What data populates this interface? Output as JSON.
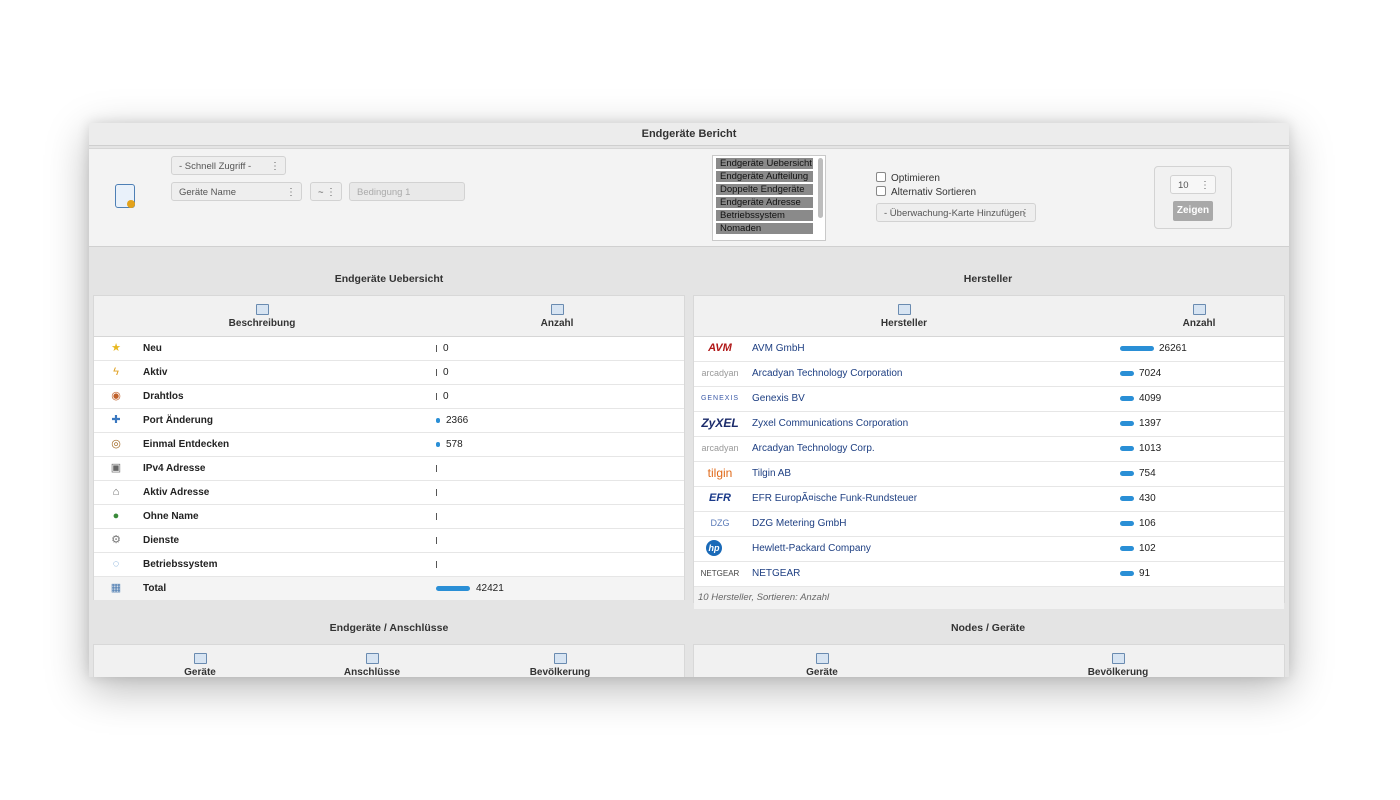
{
  "window": {
    "title": "Endgeräte Bericht"
  },
  "toolbar": {
    "quick_access": "- Schnell Zugriff -",
    "field": "Geräte Name",
    "operator": "~",
    "condition_placeholder": "Bedingung 1",
    "reports": [
      "Endgeräte Uebersicht",
      "Endgeräte Aufteilung",
      "Doppelte Endgeräte",
      "Endgeräte Adresse",
      "Betriebssystem",
      "Nomaden"
    ],
    "optimize_label": "Optimieren",
    "alt_sort_label": "Alternativ Sortieren",
    "add_map": "- Überwachung-Karte Hinzufügen",
    "count": "10",
    "show_button": "Zeigen"
  },
  "overview": {
    "title": "Endgeräte Uebersicht",
    "col_desc": "Beschreibung",
    "col_count": "Anzahl",
    "rows": [
      {
        "icon": "star-icon",
        "label": "Neu",
        "value": "0",
        "fraction": 0
      },
      {
        "icon": "lightning-icon",
        "label": "Aktiv",
        "value": "0",
        "fraction": 0
      },
      {
        "icon": "wireless-icon",
        "label": "Drahtlos",
        "value": "0",
        "fraction": 0
      },
      {
        "icon": "port-change-icon",
        "label": "Port Änderung",
        "value": "2366",
        "fraction": 0.056
      },
      {
        "icon": "eye-icon",
        "label": "Einmal Entdecken",
        "value": "578",
        "fraction": 0.014
      },
      {
        "icon": "ipv4-icon",
        "label": "IPv4 Adresse",
        "value": "",
        "fraction": 0
      },
      {
        "icon": "active-address-icon",
        "label": "Aktiv Adresse",
        "value": "",
        "fraction": 0
      },
      {
        "icon": "no-name-icon",
        "label": "Ohne Name",
        "value": "",
        "fraction": 0
      },
      {
        "icon": "gear-icon",
        "label": "Dienste",
        "value": "",
        "fraction": 0
      },
      {
        "icon": "os-icon",
        "label": "Betriebssystem",
        "value": "",
        "fraction": 0
      },
      {
        "icon": "network-icon",
        "label": "Total",
        "value": "42421",
        "fraction": 1
      }
    ]
  },
  "vendors": {
    "title": "Hersteller",
    "col_vendor": "Hersteller",
    "col_count": "Anzahl",
    "rows": [
      {
        "logo": "AVM",
        "name": "AVM GmbH",
        "value": "26261",
        "fraction": 1
      },
      {
        "logo": "arcadyan",
        "name": "Arcadyan Technology Corporation",
        "value": "7024",
        "fraction": 0.27
      },
      {
        "logo": "GENEXIS",
        "name": "Genexis BV",
        "value": "4099",
        "fraction": 0.16
      },
      {
        "logo": "ZyXEL",
        "name": "Zyxel Communications Corporation",
        "value": "1397",
        "fraction": 0.053
      },
      {
        "logo": "arcadyan",
        "name": "Arcadyan Technology Corp.",
        "value": "1013",
        "fraction": 0.039
      },
      {
        "logo": "tilgin",
        "name": "Tilgin AB",
        "value": "754",
        "fraction": 0.029
      },
      {
        "logo": "EFR",
        "name": "EFR EuropÃ¤ische Funk-Rundsteuer",
        "value": "430",
        "fraction": 0.016
      },
      {
        "logo": "DZG",
        "name": "DZG Metering GmbH",
        "value": "106",
        "fraction": 0.004
      },
      {
        "logo": "hp",
        "name": "Hewlett-Packard Company",
        "value": "102",
        "fraction": 0.004
      },
      {
        "logo": "NETGEAR",
        "name": "NETGEAR",
        "value": "91",
        "fraction": 0.003
      }
    ],
    "footer": "10 Hersteller, Sortieren: Anzahl"
  },
  "connections": {
    "title": "Endgeräte / Anschlüsse",
    "col1": "Geräte",
    "col2": "Anschlüsse",
    "col3": "Bevölkerung"
  },
  "nodes": {
    "title": "Nodes / Geräte",
    "col1": "Geräte",
    "col2": "Bevölkerung"
  },
  "colors": {
    "bar": "#2a8fd6",
    "vendor_link": "#1e3f82"
  }
}
